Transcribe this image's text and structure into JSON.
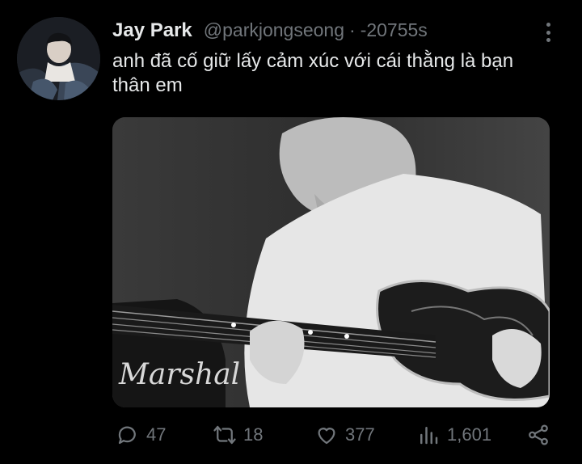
{
  "tweet": {
    "author_name": "Jay Park",
    "author_handle": "@parkjongseong",
    "separator": "·",
    "timestamp": "-20755s",
    "text": "anh đã cố giữ lấy cảm xúc với cái thằng là bạn thân em"
  },
  "actions": {
    "replies": "47",
    "retweets": "18",
    "likes": "377",
    "views": "1,601"
  },
  "icons": {
    "reply": "speech-bubble-icon",
    "retweet": "retweet-icon",
    "like": "heart-icon",
    "views": "bar-chart-icon",
    "share": "share-icon",
    "more": "vertical-dots-icon"
  },
  "colors": {
    "background": "#000000",
    "text_primary": "#e7e9ea",
    "text_secondary": "#71767b"
  }
}
